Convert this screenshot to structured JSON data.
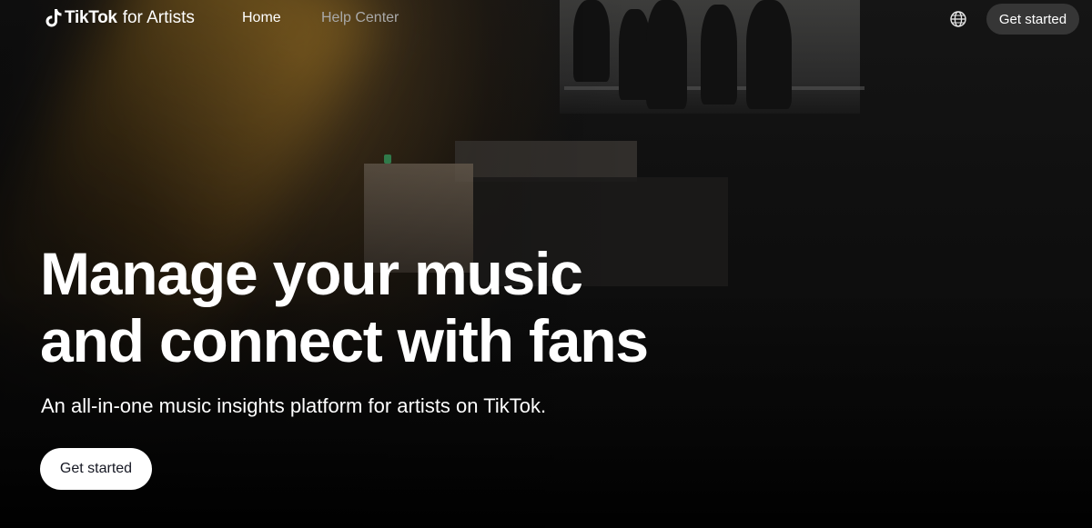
{
  "nav": {
    "logo_brand": "TikTok",
    "logo_suffix": "for Artists",
    "links": [
      {
        "label": "Home",
        "active": true
      },
      {
        "label": "Help Center",
        "active": false
      }
    ],
    "language_icon": "globe-icon",
    "cta_label": "Get started"
  },
  "hero": {
    "headline_line1": "Manage your music",
    "headline_line2": "and connect with fans",
    "subheadline": "An all-in-one music insights platform for artists on TikTok.",
    "cta_label": "Get started"
  },
  "colors": {
    "text": "#ffffff",
    "inactive_link": "#a9a9a9",
    "nav_button_bg": "#3c3c3c",
    "hero_button_bg": "#ffffff",
    "hero_button_text": "#161823"
  }
}
